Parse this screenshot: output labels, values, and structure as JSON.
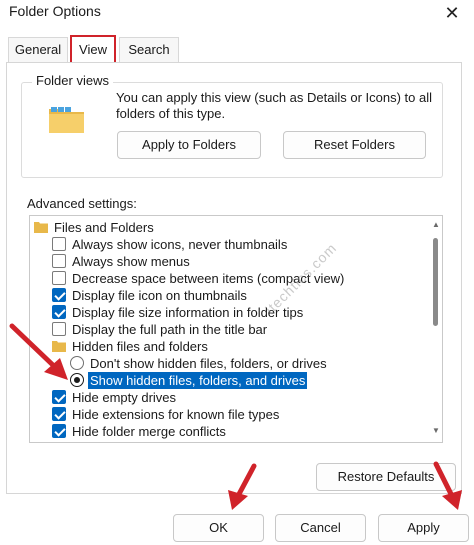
{
  "window": {
    "title": "Folder Options",
    "close_symbol": "✕"
  },
  "tabs": [
    {
      "label": "General"
    },
    {
      "label": "View"
    },
    {
      "label": "Search"
    }
  ],
  "folder_views": {
    "legend": "Folder views",
    "description": "You can apply this view (such as Details or Icons) to all folders of this type.",
    "apply_button": "Apply to Folders",
    "reset_button": "Reset Folders"
  },
  "advanced": {
    "label": "Advanced settings:",
    "items": [
      {
        "type": "folder",
        "label": "Files and Folders"
      },
      {
        "type": "checkbox",
        "checked": false,
        "label": "Always show icons, never thumbnails"
      },
      {
        "type": "checkbox",
        "checked": false,
        "label": "Always show menus"
      },
      {
        "type": "checkbox",
        "checked": false,
        "label": "Decrease space between items (compact view)"
      },
      {
        "type": "checkbox",
        "checked": true,
        "label": "Display file icon on thumbnails"
      },
      {
        "type": "checkbox",
        "checked": true,
        "label": "Display file size information in folder tips"
      },
      {
        "type": "checkbox",
        "checked": false,
        "label": "Display the full path in the title bar"
      },
      {
        "type": "folder",
        "label": "Hidden files and folders"
      },
      {
        "type": "radio",
        "selected": false,
        "label": "Don't show hidden files, folders, or drives"
      },
      {
        "type": "radio",
        "selected": true,
        "label": "Show hidden files, folders, and drives"
      },
      {
        "type": "checkbox",
        "checked": true,
        "label": "Hide empty drives"
      },
      {
        "type": "checkbox",
        "checked": true,
        "label": "Hide extensions for known file types"
      },
      {
        "type": "checkbox",
        "checked": true,
        "label": "Hide folder merge conflicts"
      }
    ]
  },
  "watermark": "itechtics.com",
  "footer": {
    "restore_button": "Restore Defaults",
    "ok_button": "OK",
    "cancel_button": "Cancel",
    "apply_button": "Apply"
  },
  "colors": {
    "accent": "#0067c0",
    "annotation_red": "#d0232a",
    "folder": "#e8b84a"
  }
}
